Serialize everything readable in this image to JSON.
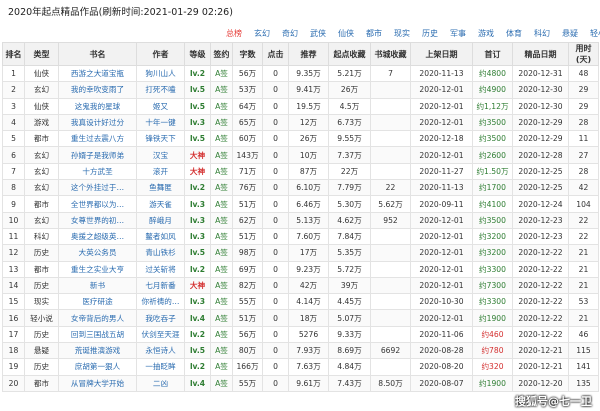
{
  "page_title": "2020年起点精品作品(刷新时间:2021-01-29 02:26)",
  "tabs": [
    "总榜",
    "玄幻",
    "奇幻",
    "武侠",
    "仙侠",
    "都市",
    "现实",
    "历史",
    "军事",
    "游戏",
    "体育",
    "科幻",
    "悬疑",
    "轻小说"
  ],
  "table": {
    "headers": [
      "排名",
      "类型",
      "书名",
      "作者",
      "等级",
      "签约",
      "字数",
      "点击",
      "推荐",
      "起点收藏",
      "书城收藏",
      "上架日期",
      "首订",
      "精品日期",
      "用时(天)"
    ],
    "rows": [
      [
        "1",
        "仙侠",
        "西游之大道宝瓶",
        "狗川山人",
        "lv.2",
        "A签",
        "56万",
        "0",
        "9.35万",
        "5.21万",
        "7",
        "2020-11-13",
        "约4800",
        "2020-12-31",
        "48"
      ],
      [
        "2",
        "玄幻",
        "我的幸吹变雨了",
        "打死不嗑",
        "lv.5",
        "A签",
        "53万",
        "0",
        "9.41万",
        "26万",
        "",
        "2020-12-01",
        "约4900",
        "2020-12-30",
        "29"
      ],
      [
        "3",
        "仙侠",
        "这鬼我的星球",
        "姬又",
        "lv.5",
        "A签",
        "64万",
        "0",
        "19.5万",
        "4.5万",
        "",
        "2020-12-01",
        "约1,12万",
        "2020-12-30",
        "29"
      ],
      [
        "4",
        "游戏",
        "我真设计好过分",
        "十年一键",
        "lv.3",
        "A签",
        "65万",
        "0",
        "12万",
        "6.73万",
        "",
        "2020-12-01",
        "约3500",
        "2020-12-29",
        "28"
      ],
      [
        "5",
        "都市",
        "重生过去震八方",
        "锋铁天下",
        "lv.5",
        "A签",
        "60万",
        "0",
        "26万",
        "9.55万",
        "",
        "2020-12-18",
        "约3500",
        "2020-12-29",
        "11"
      ],
      [
        "6",
        "玄幻",
        "孙婿子是我师弟",
        "汉宝",
        "大神",
        "A签",
        "143万",
        "0",
        "10万",
        "7.37万",
        "",
        "2020-12-01",
        "约2600",
        "2020-12-28",
        "27"
      ],
      [
        "7",
        "玄幻",
        "十方武圣",
        "滚开",
        "大神",
        "A签",
        "71万",
        "0",
        "87万",
        "22万",
        "",
        "2020-11-27",
        "约1.50万",
        "2020-12-25",
        "28"
      ],
      [
        "8",
        "玄幻",
        "这个外挂过于…",
        "鱼舞匿",
        "lv.2",
        "A签",
        "76万",
        "0",
        "6.10万",
        "7.79万",
        "22",
        "2020-11-13",
        "约1700",
        "2020-12-25",
        "42"
      ],
      [
        "9",
        "都市",
        "全世界都以为…",
        "游天雀",
        "lv.3",
        "A签",
        "51万",
        "0",
        "6.46万",
        "5.30万",
        "5.62万",
        "2020-09-11",
        "约4100",
        "2020-12-24",
        "104"
      ],
      [
        "10",
        "玄幻",
        "女尊世界的初…",
        "醉峨月",
        "lv.3",
        "A签",
        "62万",
        "0",
        "5.13万",
        "4.62万",
        "952",
        "2020-12-01",
        "约3500",
        "2020-12-23",
        "22"
      ],
      [
        "11",
        "科幻",
        "奥援之超级英…",
        "鳌者如风",
        "lv.3",
        "A签",
        "51万",
        "0",
        "7.60万",
        "7.84万",
        "",
        "2020-12-01",
        "约3200",
        "2020-12-23",
        "22"
      ],
      [
        "12",
        "历史",
        "大英公务员",
        "青山铁杉",
        "lv.5",
        "A签",
        "98万",
        "0",
        "17万",
        "5.35万",
        "",
        "2020-12-01",
        "约3200",
        "2020-12-22",
        "21"
      ],
      [
        "13",
        "都市",
        "重生之实业大亨",
        "过关斩将",
        "lv.2",
        "A签",
        "69万",
        "0",
        "9.23万",
        "5.72万",
        "",
        "2020-12-01",
        "约3300",
        "2020-12-22",
        "21"
      ],
      [
        "14",
        "历史",
        "新书",
        "七月新番",
        "大神",
        "A签",
        "82万",
        "0",
        "42万",
        "39万",
        "",
        "2020-12-01",
        "约7300",
        "2020-12-22",
        "21"
      ],
      [
        "15",
        "现实",
        "医疗研途",
        "你祈祷的…",
        "lv.3",
        "A签",
        "55万",
        "0",
        "4.14万",
        "4.45万",
        "",
        "2020-10-30",
        "约3300",
        "2020-12-22",
        "53"
      ],
      [
        "16",
        "轻小说",
        "女帝背后的男人",
        "我吃吞子",
        "lv.4",
        "A签",
        "51万",
        "0",
        "18万",
        "5.07万",
        "",
        "2020-12-01",
        "约1900",
        "2020-12-22",
        "21"
      ],
      [
        "17",
        "历史",
        "回到三国战五胡",
        "伏剑至天涯",
        "lv.2",
        "A签",
        "56万",
        "0",
        "5276",
        "9.33万",
        "",
        "2020-11-06",
        "约460",
        "2020-12-22",
        "46"
      ],
      [
        "18",
        "悬疑",
        "荒诞推演游戏",
        "永恒诗人",
        "lv.5",
        "A签",
        "80万",
        "0",
        "7.93万",
        "8.69万",
        "6692",
        "2020-08-28",
        "约780",
        "2020-12-21",
        "115"
      ],
      [
        "19",
        "历史",
        "庶胡第一狠人",
        "一抽眨眸",
        "lv.2",
        "A签",
        "166万",
        "0",
        "7.63万",
        "4.84万",
        "",
        "2020-08-20",
        "约320",
        "2020-12-21",
        "141"
      ],
      [
        "20",
        "都市",
        "从冒牌大学开始",
        "二凶",
        "lv.4",
        "A签",
        "55万",
        "0",
        "9.61万",
        "7.43万",
        "8.50万",
        "2020-08-07",
        "约1900",
        "2020-12-20",
        "135"
      ]
    ]
  },
  "watermark": "搜狐号@七一卫",
  "colors": {
    "link": "#2b6cb0",
    "active_tab": "#e53935",
    "green": "#2e7d32",
    "red": "#d32f2f"
  }
}
